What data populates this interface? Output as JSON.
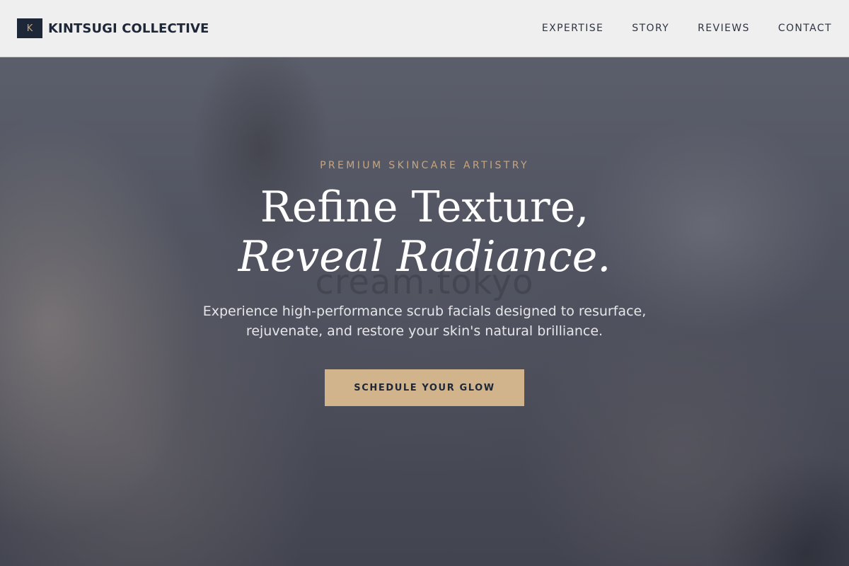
{
  "brand": {
    "mark": "K",
    "name": "KINTSUGI COLLECTIVE"
  },
  "nav": {
    "items": [
      {
        "label": "EXPERTISE"
      },
      {
        "label": "STORY"
      },
      {
        "label": "REVIEWS"
      },
      {
        "label": "CONTACT"
      }
    ]
  },
  "hero": {
    "eyebrow": "PREMIUM SKINCARE ARTISTRY",
    "headline_line1": "Refine Texture,",
    "headline_line2": "Reveal Radiance.",
    "subcopy": "Experience high-performance scrub facials designed to resurface, rejuvenate, and restore your skin's natural brilliance.",
    "cta_label": "SCHEDULE YOUR GLOW",
    "watermark": "cream.tokyo"
  },
  "colors": {
    "navy": "#1e2738",
    "gold": "#d2b48c",
    "eyebrow_gold": "#c4a582",
    "header_bg": "#efeff0"
  }
}
